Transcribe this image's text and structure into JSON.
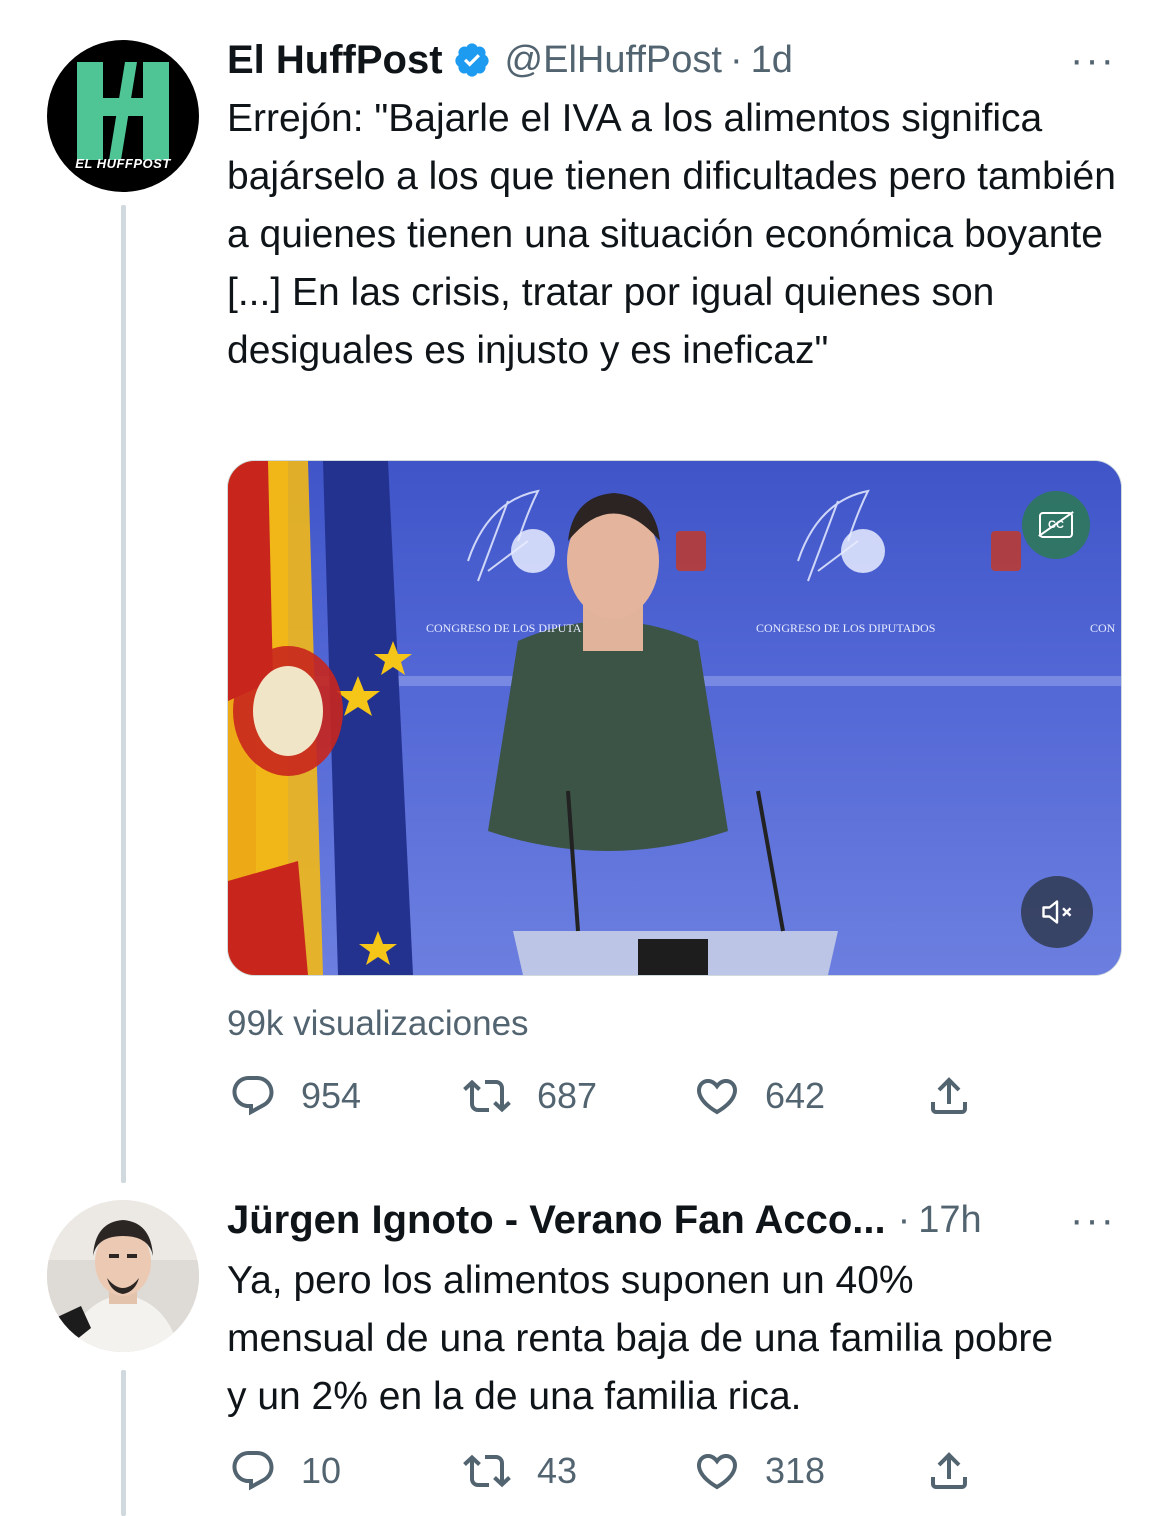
{
  "tweet": {
    "avatar_text": "EL HUFFPOST",
    "display_name": "El HuffPost",
    "handle": "@ElHuffPost",
    "separator": "·",
    "time": "1d",
    "more": "···",
    "text": "Errejón: \"Bajarle el IVA a los alimentos significa bajárselo a los que tienen dificultades pero también a quienes tienen una situación económica boyante [...] En las crisis, tratar por igual quienes son desiguales es injusto y es ineficaz\"",
    "video": {
      "backdrop_text": [
        "CONGRESO DE LOS DIPUTA",
        "CONGRESO DE LOS DIPUTADOS",
        "CON"
      ],
      "cc_label": "CC",
      "mute_icon": "muted-speaker-icon"
    },
    "views": "99k visualizaciones",
    "stats": {
      "replies": "954",
      "retweets": "687",
      "likes": "642"
    }
  },
  "reply": {
    "display_name": "Jürgen Ignoto - Verano Fan Acco...",
    "separator": "·",
    "time": "17h",
    "more": "···",
    "text": "Ya, pero los alimentos suponen un 40% mensual de una renta baja de una familia pobre y un 2% en la de una familia rica.",
    "stats": {
      "replies": "10",
      "retweets": "43",
      "likes": "318"
    }
  },
  "colors": {
    "verified": "#1d9bf0",
    "secondary_text": "#536471",
    "thread_line": "#cfd9de",
    "huffpost_green": "#4fc596"
  }
}
